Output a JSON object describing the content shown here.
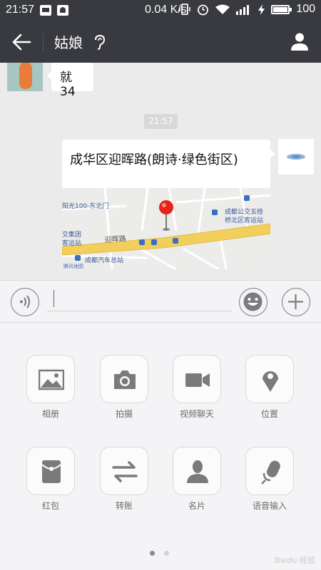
{
  "status_bar": {
    "time": "21:57",
    "net_speed": "0.04 K/s",
    "battery": "100",
    "battery_level": 1.0
  },
  "header": {
    "contact_name": "姑娘",
    "back_icon": "arrow-left-icon",
    "earpiece_icon": "ear-icon",
    "profile_icon": "person-icon"
  },
  "messages": {
    "incoming_text": "就34",
    "timestamp": "21:57",
    "location": {
      "title": "成华区迎晖路(朗诗·绿色街区)",
      "map_labels": {
        "road": "迎晖路",
        "place_left_top": "阳光100-东北门",
        "place_left_mid": "交集团",
        "place_left_low": "客运站",
        "bus_station": "成都公交五桂",
        "bus_station_2": "桥北区客运站",
        "coach_station": "成都汽车总站",
        "provider": "腾讯地图"
      }
    }
  },
  "input": {
    "voice_icon": "voice-wave-icon",
    "emoji_icon": "smiley-icon",
    "plus_icon": "plus-icon",
    "value": ""
  },
  "panel": {
    "tools": [
      {
        "label": "相册",
        "icon": "image-icon"
      },
      {
        "label": "拍摄",
        "icon": "camera-icon"
      },
      {
        "label": "视频聊天",
        "icon": "video-camera-icon"
      },
      {
        "label": "位置",
        "icon": "location-pin-icon"
      },
      {
        "label": "红包",
        "icon": "red-envelope-icon"
      },
      {
        "label": "转账",
        "icon": "transfer-arrows-icon"
      },
      {
        "label": "名片",
        "icon": "contact-card-icon"
      },
      {
        "label": "语音输入",
        "icon": "microphone-icon"
      }
    ],
    "page_indicator": {
      "current": 1,
      "total": 2
    }
  },
  "colors": {
    "titlebar": "#393a3f",
    "chat_bg": "#ebebeb",
    "panel_bg": "#f4f4f6",
    "icon_grey": "#7a7a7c",
    "map_road": "#f2cf5a",
    "map_pin": "#e5231b"
  },
  "watermark": "Baidu 经验"
}
